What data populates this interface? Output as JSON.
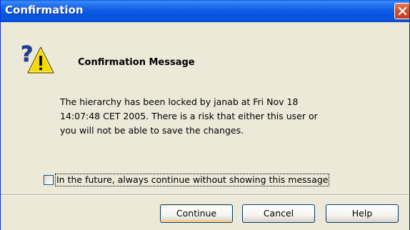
{
  "window": {
    "title": "Confirmation",
    "close_icon": "close-icon"
  },
  "header": {
    "icon": "question-warning-icon",
    "heading": "Confirmation Message"
  },
  "message": {
    "text": "The hierarchy has been locked by janab at Fri Nov 18\n14:07:48 CET 2005. There is a risk that either this user or\nyou will not be able to save the changes."
  },
  "option": {
    "checked": false,
    "label": "In the future, always continue without showing this message"
  },
  "buttons": {
    "continue": "Continue",
    "cancel": "Cancel",
    "help": "Help"
  },
  "colors": {
    "titlebar": "#0553dd",
    "dialog_bg": "#ece9d8",
    "close_button": "#d9542f",
    "warning_yellow": "#f5d800"
  }
}
